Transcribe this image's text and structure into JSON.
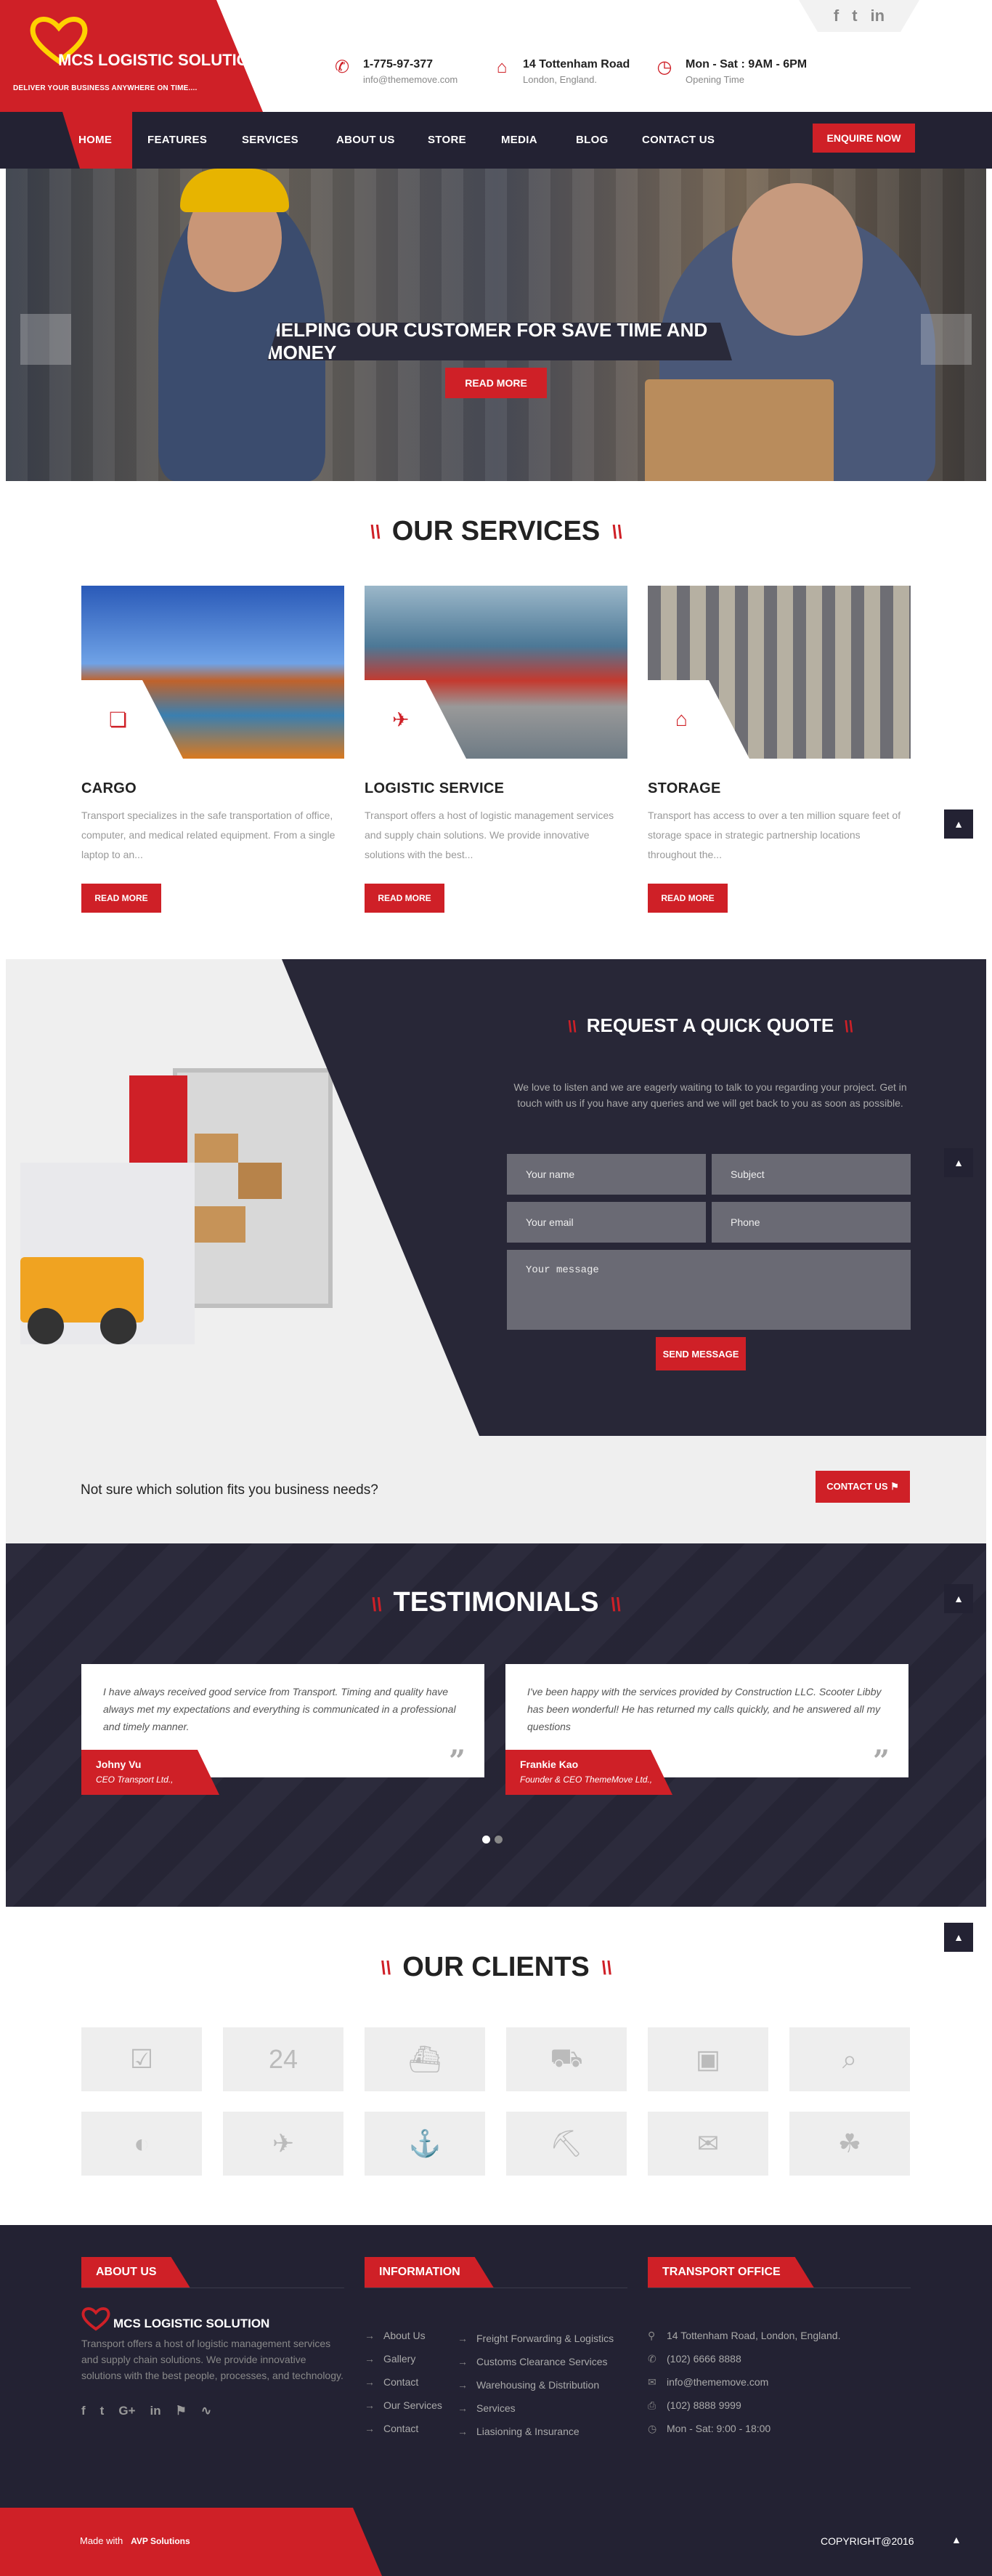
{
  "header": {
    "logo_word": "MCS",
    "logo_title": "LOGISTIC SOLUTION",
    "logo_tagline": "DELIVER YOUR BUSINESS ANYWHERE ON TIME....",
    "social": [
      "f",
      "t",
      "in"
    ],
    "phone": "1-775-97-377",
    "email": "info@thememove.com",
    "address_line1": "14 Tottenham Road",
    "address_line2": "London, England.",
    "hours_line1": "Mon - Sat : 9AM - 6PM",
    "hours_line2": "Opening Time"
  },
  "nav": {
    "items": [
      "HOME",
      "FEATURES",
      "SERVICES",
      "ABOUT US",
      "STORE",
      "MEDIA",
      "BLOG",
      "CONTACT US"
    ],
    "enquire": "ENQUIRE NOW"
  },
  "hero": {
    "title": "HELPING OUR CUSTOMER FOR SAVE TIME AND MONEY",
    "button": "READ MORE"
  },
  "services": {
    "title": "OUR SERVICES",
    "items": [
      {
        "title": "CARGO",
        "text": "Transport specializes in the safe transportation of office, computer, and medical related equipment. From a single laptop to an...",
        "button": "READ MORE",
        "icon": "cube-icon"
      },
      {
        "title": "LOGISTIC SERVICE",
        "text": "Transport offers a host of logistic management services and supply chain solutions. We provide innovative solutions with the best...",
        "button": "READ MORE",
        "icon": "plane-icon"
      },
      {
        "title": "STORAGE",
        "text": "Transport has access to over a ten million square feet of storage space in strategic partnership locations throughout the...",
        "button": "READ MORE",
        "icon": "warehouse-icon"
      }
    ]
  },
  "quote": {
    "title": "REQUEST A QUICK QUOTE",
    "text": "We love to listen and we are eagerly waiting to talk to you regarding your project. Get in touch with us if you have any queries and we will get back to you as soon as possible.",
    "name_ph": "Your name",
    "subject_ph": "Subject",
    "email_ph": "Your email",
    "phone_ph": "Phone",
    "message_ph": "Your message",
    "send": "SEND MESSAGE"
  },
  "cta": {
    "text": "Not sure which solution fits you business needs?",
    "button": "CONTACT US ⚑"
  },
  "testimonials": {
    "title": "TESTIMONIALS",
    "items": [
      {
        "quote": "I have always received good service from Transport. Timing and quality have always met my expectations and everything is communicated in a professional and timely manner.",
        "name": "Johny Vu",
        "role": "CEO Transport Ltd.,"
      },
      {
        "quote": "I've been happy with the services provided by Construction LLC. Scooter Libby has been wonderful! He has returned my calls quickly, and he answered all my questions",
        "name": "Frankie Kao",
        "role": "Founder & CEO ThemeMove Ltd.,"
      }
    ]
  },
  "clients": {
    "title": "OUR CLIENTS",
    "icons": [
      "☑",
      "24",
      "⛴",
      "⛟",
      "▣",
      "⌕",
      "◐",
      "✈",
      "⚓",
      "⛏",
      "✉",
      "☘"
    ]
  },
  "footer": {
    "about_head": "ABOUT US",
    "about_logo": "MCS LOGISTIC SOLUTION",
    "about_text": "Transport offers a host of logistic management services and supply chain solutions. We provide innovative solutions with the best people, processes, and technology.",
    "social": [
      "f",
      "t",
      "G+",
      "in",
      "⚑",
      "∿"
    ],
    "info_head": "INFORMATION",
    "links_left": [
      "About Us",
      "Gallery",
      "Contact",
      "Our Services",
      "Contact"
    ],
    "links_right": [
      "Freight Forwarding & Logistics",
      "Customs Clearance Services",
      "Warehousing & Distribution",
      "Services",
      "Liasioning & Insurance"
    ],
    "office_head": "TRANSPORT OFFICE",
    "office": [
      "14 Tottenham Road, London, England.",
      "(102) 6666 8888",
      "info@thememove.com",
      "(102) 8888 9999",
      "Mon - Sat: 9:00 - 18:00"
    ],
    "made_with": "Made with",
    "made_by": "AVP Solutions",
    "copyright": "COPYRIGHT@2016"
  },
  "colors": {
    "accent": "#cf2027",
    "dark": "#232233"
  }
}
